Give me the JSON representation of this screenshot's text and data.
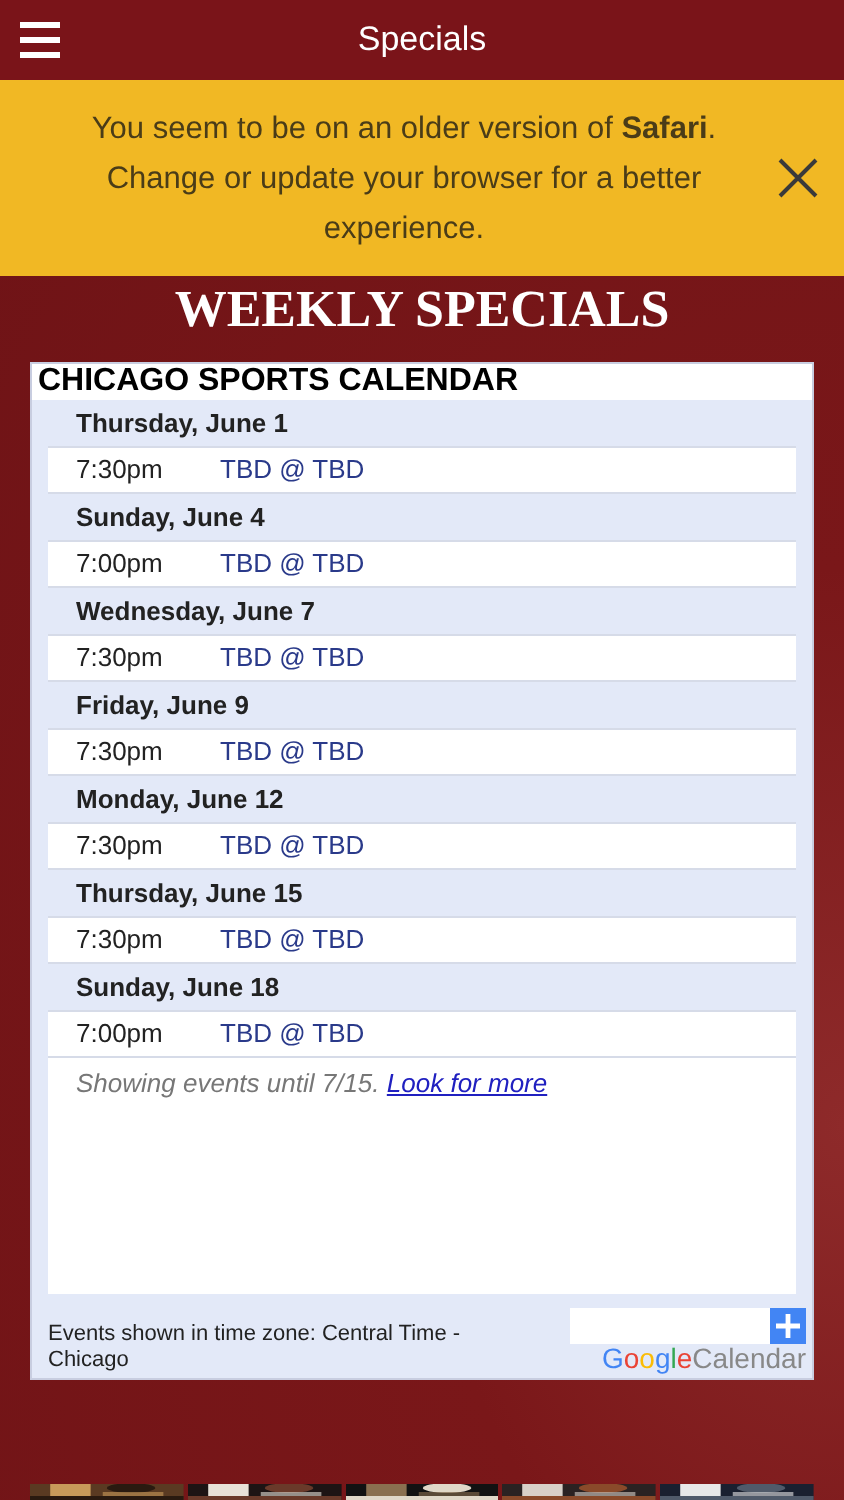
{
  "header": {
    "title": "Specials"
  },
  "banner": {
    "text": "You seem to be on an older version of **Safari**. Change or update your browser for a better experience."
  },
  "heading": "WEEKLY SPECIALS",
  "calendar": {
    "title": "CHICAGO SPORTS CALENDAR",
    "days": [
      {
        "date": "Thursday, June 1",
        "events": [
          {
            "time": "7:30pm",
            "title": "TBD @ TBD"
          }
        ]
      },
      {
        "date": "Sunday, June 4",
        "events": [
          {
            "time": "7:00pm",
            "title": "TBD @ TBD"
          }
        ]
      },
      {
        "date": "Wednesday, June 7",
        "events": [
          {
            "time": "7:30pm",
            "title": "TBD @ TBD"
          }
        ]
      },
      {
        "date": "Friday, June 9",
        "events": [
          {
            "time": "7:30pm",
            "title": "TBD @ TBD"
          }
        ]
      },
      {
        "date": "Monday, June 12",
        "events": [
          {
            "time": "7:30pm",
            "title": "TBD @ TBD"
          }
        ]
      },
      {
        "date": "Thursday, June 15",
        "events": [
          {
            "time": "7:30pm",
            "title": "TBD @ TBD"
          }
        ]
      },
      {
        "date": "Sunday, June 18",
        "events": [
          {
            "time": "7:00pm",
            "title": "TBD @ TBD"
          }
        ]
      }
    ],
    "note": "Showing events until 7/15.",
    "more_link": "Look for more",
    "timezone": "Events shown in time zone: Central Time - Chicago",
    "brand": "Google",
    "brand_suffix": "Calendar"
  }
}
